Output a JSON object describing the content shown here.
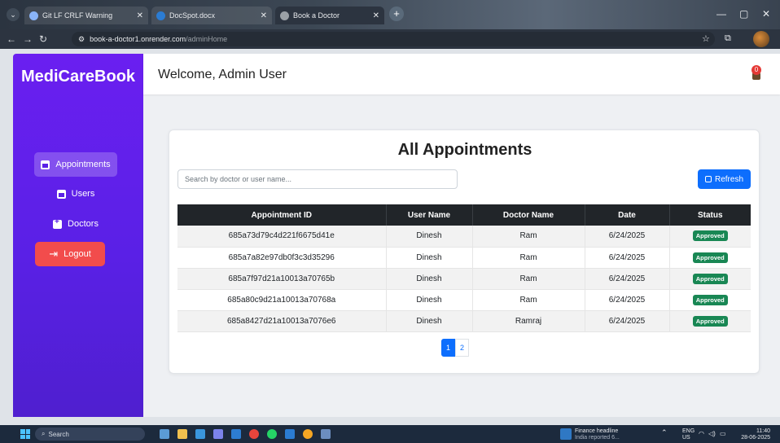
{
  "browser": {
    "tabs": [
      {
        "title": "Git LF CRLF Warning",
        "color": "#8ab4f8"
      },
      {
        "title": "DocSpot.docx",
        "color": "#2b7cd3"
      },
      {
        "title": "Book a Doctor",
        "color": "#9aa0a6"
      }
    ],
    "url_host": "book-a-doctor1.onrender.com",
    "url_path": "/adminHome"
  },
  "sidebar": {
    "brand": "MediCareBook",
    "items": [
      {
        "label": "Appointments",
        "icon": "calendar-icon"
      },
      {
        "label": "Users",
        "icon": "calendar-icon"
      },
      {
        "label": "Doctors",
        "icon": "plus-square-icon"
      }
    ],
    "logout_label": "Logout",
    "logout_icon": "logout-icon"
  },
  "header": {
    "welcome": "Welcome, Admin User",
    "notification_count": "0"
  },
  "appointments": {
    "title": "All Appointments",
    "search_placeholder": "Search by doctor or user name...",
    "refresh_label": "Refresh",
    "columns": [
      "Appointment ID",
      "User Name",
      "Doctor Name",
      "Date",
      "Status"
    ],
    "rows": [
      {
        "id": "685a73d79c4d221f6675d41e",
        "user": "Dinesh",
        "doctor": "Ram",
        "date": "6/24/2025",
        "status": "Approved"
      },
      {
        "id": "685a7a82e97db0f3c3d35296",
        "user": "Dinesh",
        "doctor": "Ram",
        "date": "6/24/2025",
        "status": "Approved"
      },
      {
        "id": "685a7f97d21a10013a70765b",
        "user": "Dinesh",
        "doctor": "Ram",
        "date": "6/24/2025",
        "status": "Approved"
      },
      {
        "id": "685a80c9d21a10013a70768a",
        "user": "Dinesh",
        "doctor": "Ram",
        "date": "6/24/2025",
        "status": "Approved"
      },
      {
        "id": "685a8427d21a10013a7076e6",
        "user": "Dinesh",
        "doctor": "Ramraj",
        "date": "6/24/2025",
        "status": "Approved"
      }
    ],
    "pages": [
      "1",
      "2"
    ],
    "current_page": "1"
  },
  "taskbar": {
    "search_label": "Search",
    "news_title": "Finance headline",
    "news_sub": "India reported 6...",
    "lang": "ENG",
    "region": "US",
    "time": "11:40",
    "date": "28-06-2025"
  }
}
